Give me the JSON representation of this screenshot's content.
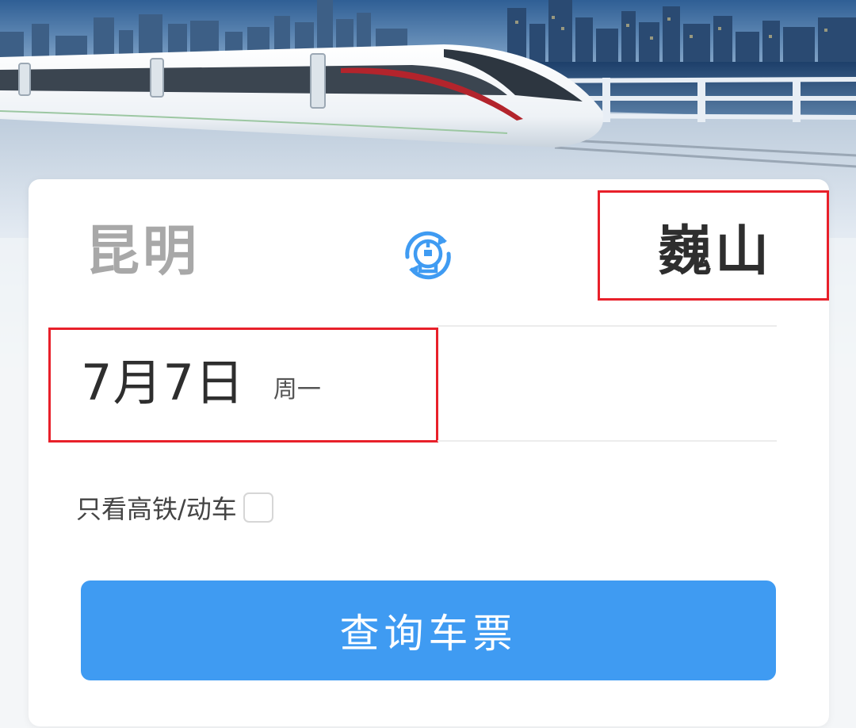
{
  "route": {
    "from_station": "昆明",
    "to_station": "巍山",
    "swap_icon": "railway-logo-swap-icon"
  },
  "date": {
    "day": "7月7日",
    "weekday": "周一"
  },
  "filter": {
    "label": "只看高铁/动车",
    "checked": false
  },
  "search": {
    "button_label": "查询车票"
  },
  "colors": {
    "accent": "#3f9bf2",
    "highlight": "#e8202a",
    "from_text": "#a8a8a8",
    "to_text": "#2e2e2e"
  }
}
